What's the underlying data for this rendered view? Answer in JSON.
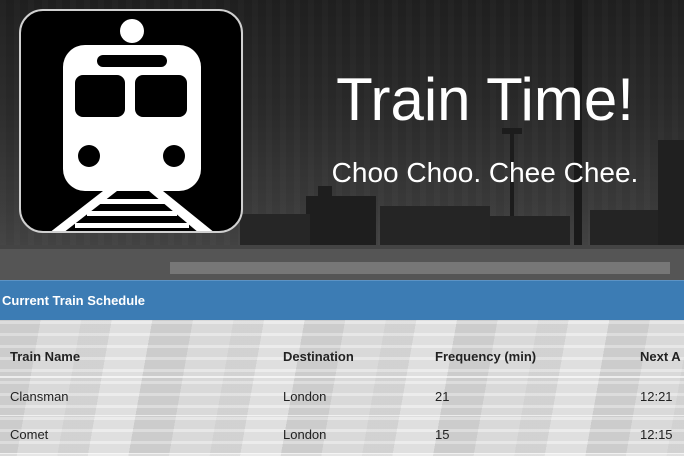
{
  "header": {
    "title": "Train Time!",
    "subtitle": "Choo Choo. Chee Chee.",
    "logo_icon": "train-icon"
  },
  "schedule": {
    "heading": "Current Train Schedule",
    "columns": [
      "Train Name",
      "Destination",
      "Frequency (min)",
      "Next A"
    ],
    "rows": [
      [
        "Clansman",
        "London",
        "21",
        "12:21"
      ],
      [
        "Comet",
        "London",
        "15",
        "12:15"
      ]
    ]
  },
  "colors": {
    "panel_heading": "#3c7cb4",
    "header_background": "#2a2a2a"
  }
}
